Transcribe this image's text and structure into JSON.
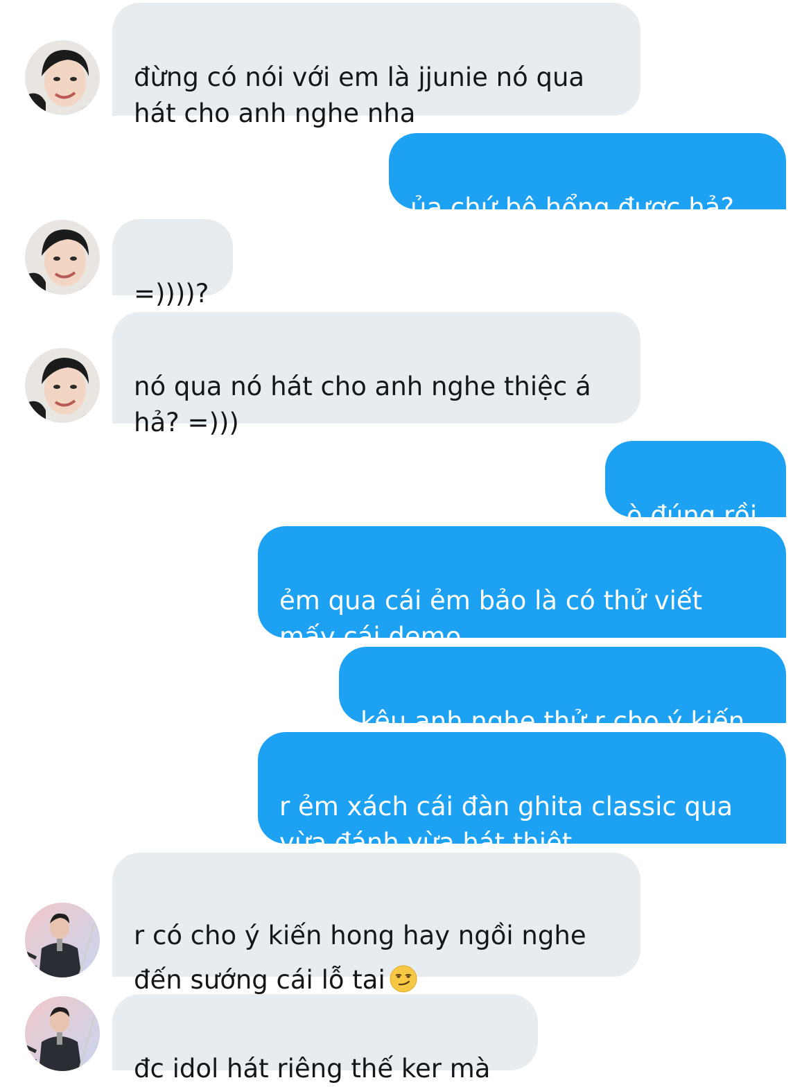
{
  "messages": [
    {
      "side": "in",
      "text": "đừng có nói với em là jjunie nó qua\nhát cho anh nghe nha"
    },
    {
      "side": "out",
      "text": "ủa chứ bộ hổng được hả?"
    },
    {
      "side": "in",
      "text": "=))))?"
    },
    {
      "side": "in",
      "text": "nó qua nó hát cho anh nghe thiệc á\nhả? =)))"
    },
    {
      "side": "out",
      "text": "ò đúng rồi"
    },
    {
      "side": "out",
      "text": "ẻm qua cái ẻm bảo là có thử viết\nmấy cái demo"
    },
    {
      "side": "out",
      "text": "kêu anh nghe thử r cho ý kiến"
    },
    {
      "side": "out",
      "text": "r ẻm xách cái đàn ghita classic qua\nvừa đánh vừa hát thiệt"
    },
    {
      "side": "in",
      "text": "r có cho ý kiến hong hay ngồi nghe\nđến sướng cái lỗ tai",
      "emoji": "smirking-face-emoji"
    },
    {
      "side": "in",
      "text": "đc idol hát riêng thế ker mà"
    }
  ],
  "colors": {
    "incoming_bubble": "#e6ecf0",
    "outgoing_bubble": "#1da1f2",
    "incoming_text": "#14171a",
    "outgoing_text": "#ffffff"
  }
}
